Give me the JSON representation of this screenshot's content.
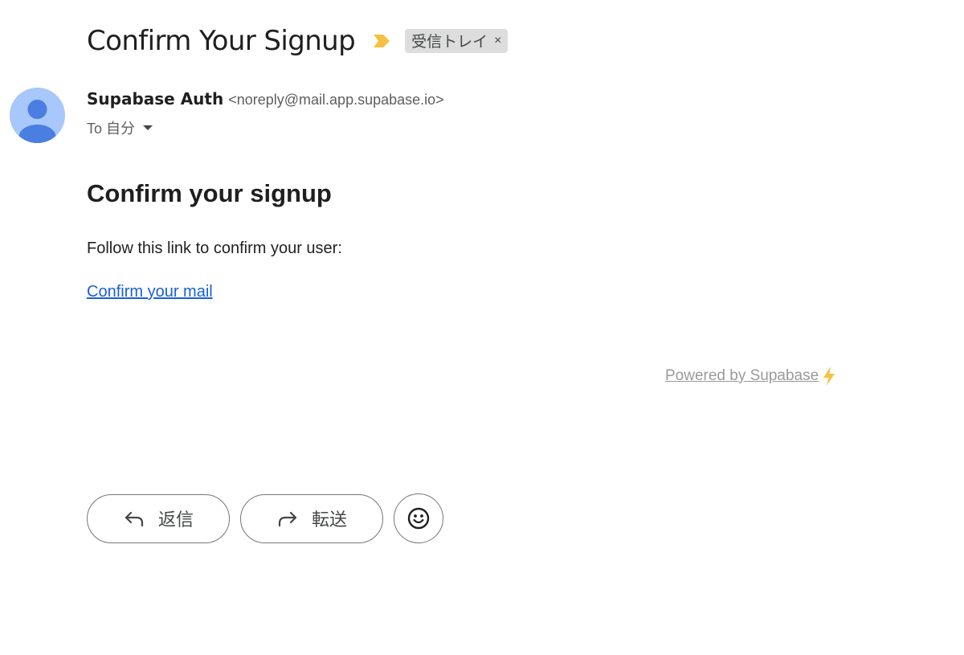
{
  "email": {
    "subject": "Confirm Your Signup",
    "label": "受信トレイ",
    "label_close": "×",
    "importance_icon": "importance-marker-icon",
    "sender_name": "Supabase Auth",
    "sender_email": "<noreply@mail.app.supabase.io>",
    "to_text": "To 自分",
    "colors": {
      "avatar_bg": "#a8c7fa",
      "avatar_fg": "#4a7ee0",
      "importance": "#f5c142",
      "link": "#1a5fd8",
      "bolt": "#f5c142"
    }
  },
  "body": {
    "heading": "Confirm your signup",
    "text": "Follow this link to confirm your user:",
    "link_text": "Confirm your mail",
    "powered_text": "Powered by Supabase "
  },
  "actions": {
    "reply_label": "返信",
    "forward_label": "転送",
    "reply_icon": "reply-arrow-icon",
    "forward_icon": "forward-arrow-icon",
    "emoji_icon": "smiley-emoji-icon"
  }
}
